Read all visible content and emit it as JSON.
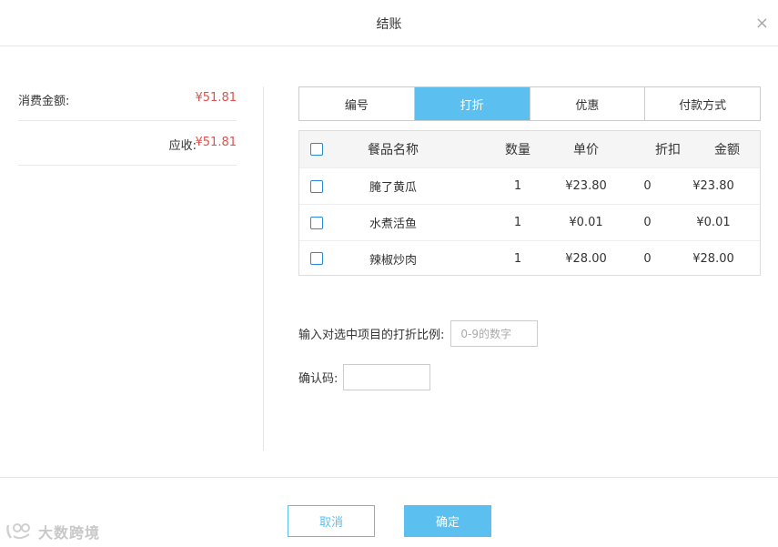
{
  "dialog": {
    "title": "结账",
    "close_glyph": "×"
  },
  "summary": {
    "consumption_label": "消费金额:",
    "consumption_value": "¥51.81",
    "receivable_label": "应收:",
    "receivable_value": "¥51.81"
  },
  "tabs": [
    {
      "label": "编号",
      "active": false
    },
    {
      "label": "打折",
      "active": true
    },
    {
      "label": "优惠",
      "active": false
    },
    {
      "label": "付款方式",
      "active": false
    }
  ],
  "table": {
    "headers": {
      "name": "餐品名称",
      "qty": "数量",
      "price": "单价",
      "discount": "折扣",
      "amount": "金额"
    },
    "rows": [
      {
        "name": "腌了黄瓜",
        "qty": "1",
        "price": "¥23.80",
        "discount": "0",
        "amount": "¥23.80"
      },
      {
        "name": "水煮活鱼",
        "qty": "1",
        "price": "¥0.01",
        "discount": "0",
        "amount": "¥0.01"
      },
      {
        "name": "辣椒炒肉",
        "qty": "1",
        "price": "¥28.00",
        "discount": "0",
        "amount": "¥28.00"
      }
    ]
  },
  "form": {
    "discount_label": "输入对选中项目的打折比例:",
    "discount_placeholder": "0-9的数字",
    "confirm_code_label": "确认码:",
    "confirm_code_value": ""
  },
  "buttons": {
    "cancel": "取消",
    "ok": "确定"
  },
  "watermark": {
    "text": "大数跨境"
  },
  "colors": {
    "accent": "#5bc0f0",
    "amount_red": "#e0504d",
    "checkbox_blue": "#2a8ad4"
  }
}
